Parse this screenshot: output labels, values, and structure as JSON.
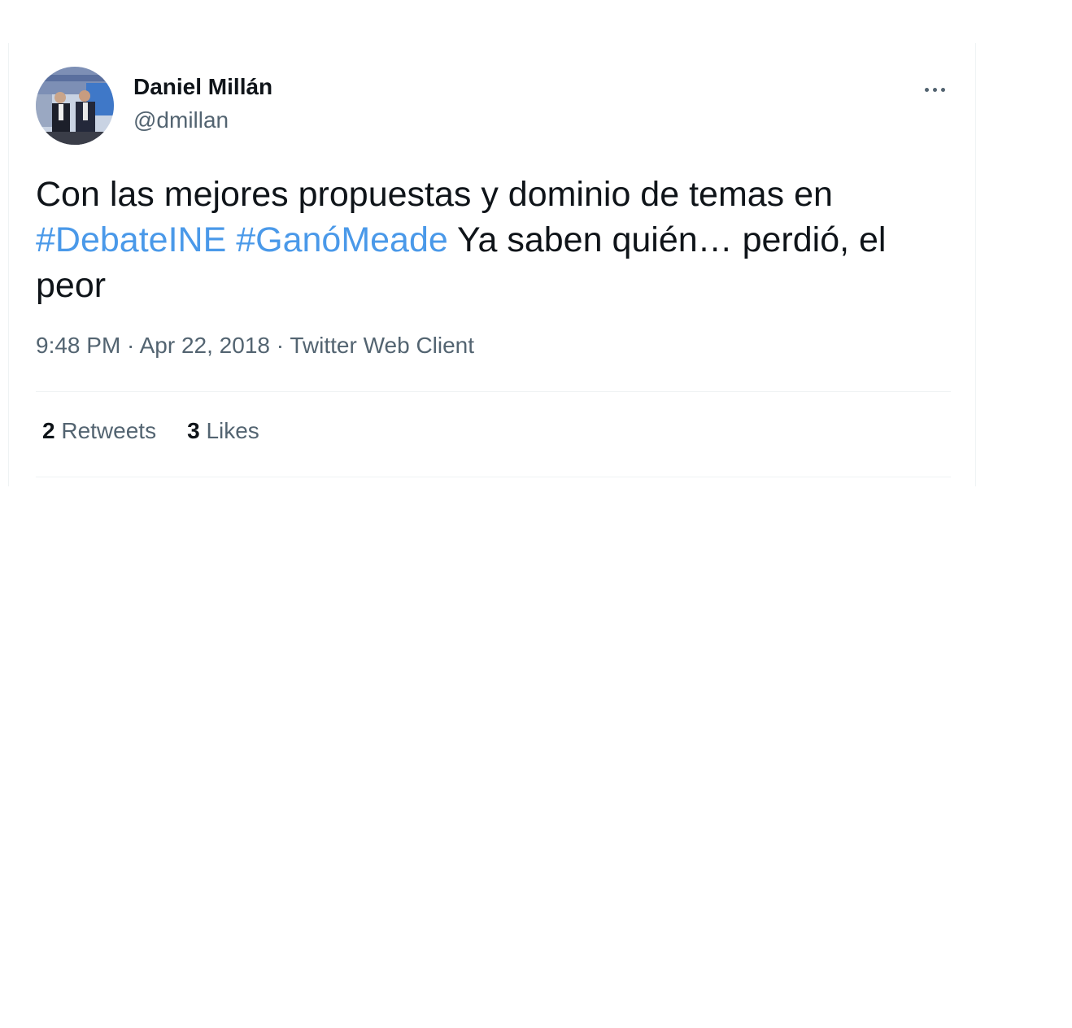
{
  "author": {
    "name": "Daniel Millán",
    "handle": "@dmillan"
  },
  "tweet": {
    "text_part1": "Con las mejores propuestas y dominio de temas en ",
    "hashtag1": "#DebateINE",
    "space": " ",
    "hashtag2": "#GanóMeade",
    "text_part2": " Ya saben quién… perdió, el peor"
  },
  "meta": {
    "time": "9:48 PM",
    "separator": " · ",
    "date": "Apr 22, 2018",
    "source": "Twitter Web Client"
  },
  "stats": {
    "retweets_count": "2",
    "retweets_label": "Retweets",
    "likes_count": "3",
    "likes_label": "Likes"
  },
  "icons": {
    "more": "more-horizontal-icon"
  },
  "colors": {
    "hashtag": "#4a99e9",
    "secondary_text": "#536471",
    "primary_text": "#0f1419",
    "divider": "#eff3f4"
  }
}
